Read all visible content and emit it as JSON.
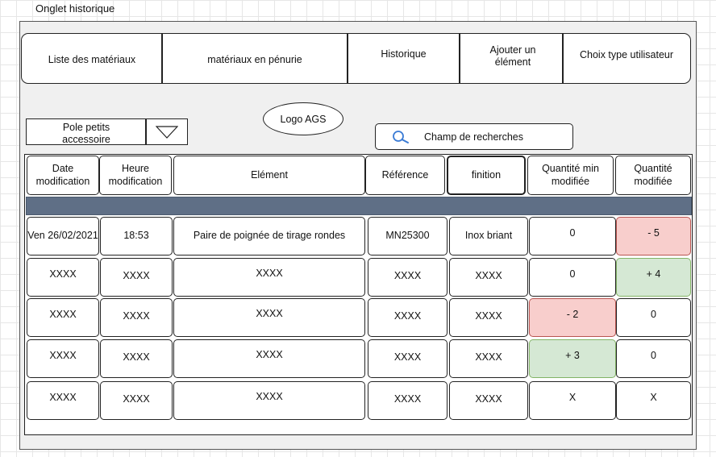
{
  "page": {
    "title": "Onglet historique"
  },
  "nav": {
    "items": [
      {
        "label": "Liste des matériaux"
      },
      {
        "label": "matériaux en pénurie"
      },
      {
        "label": "Historique"
      },
      {
        "label": "Ajouter un élément"
      },
      {
        "label": "Choix type utilisateur"
      }
    ]
  },
  "logo": {
    "text": "Logo AGS"
  },
  "filter": {
    "selected": "Pole petits accessoire"
  },
  "search": {
    "placeholder": "Champ de recherches"
  },
  "colors": {
    "negative": "#f8cecc",
    "positive": "#d5e8d4",
    "separator_band": "#5f6f86"
  },
  "table": {
    "headers": [
      "Date modification",
      "Heure modification",
      "Elément",
      "Référence",
      "finition",
      "Quantité min modifiée",
      "Quantité modifiée"
    ],
    "rows": [
      {
        "cells": [
          "Ven 26/02/2021",
          "18:53",
          "Paire de poignée de tirage rondes",
          "MN25300",
          "Inox briant",
          "0",
          "- 5"
        ],
        "highlight": [
          null,
          null,
          null,
          null,
          null,
          null,
          "negative"
        ]
      },
      {
        "cells": [
          "XXXX",
          "XXXX",
          "XXXX",
          "XXXX",
          "XXXX",
          "0",
          "+ 4"
        ],
        "highlight": [
          null,
          null,
          null,
          null,
          null,
          null,
          "positive"
        ]
      },
      {
        "cells": [
          "XXXX",
          "XXXX",
          "XXXX",
          "XXXX",
          "XXXX",
          "- 2",
          "0"
        ],
        "highlight": [
          null,
          null,
          null,
          null,
          null,
          "negative",
          null
        ]
      },
      {
        "cells": [
          "XXXX",
          "XXXX",
          "XXXX",
          "XXXX",
          "XXXX",
          "+ 3",
          "0"
        ],
        "highlight": [
          null,
          null,
          null,
          null,
          null,
          "positive",
          null
        ]
      },
      {
        "cells": [
          "XXXX",
          "XXXX",
          "XXXX",
          "XXXX",
          "XXXX",
          "X",
          "X"
        ],
        "highlight": [
          null,
          null,
          null,
          null,
          null,
          null,
          null
        ]
      }
    ]
  }
}
